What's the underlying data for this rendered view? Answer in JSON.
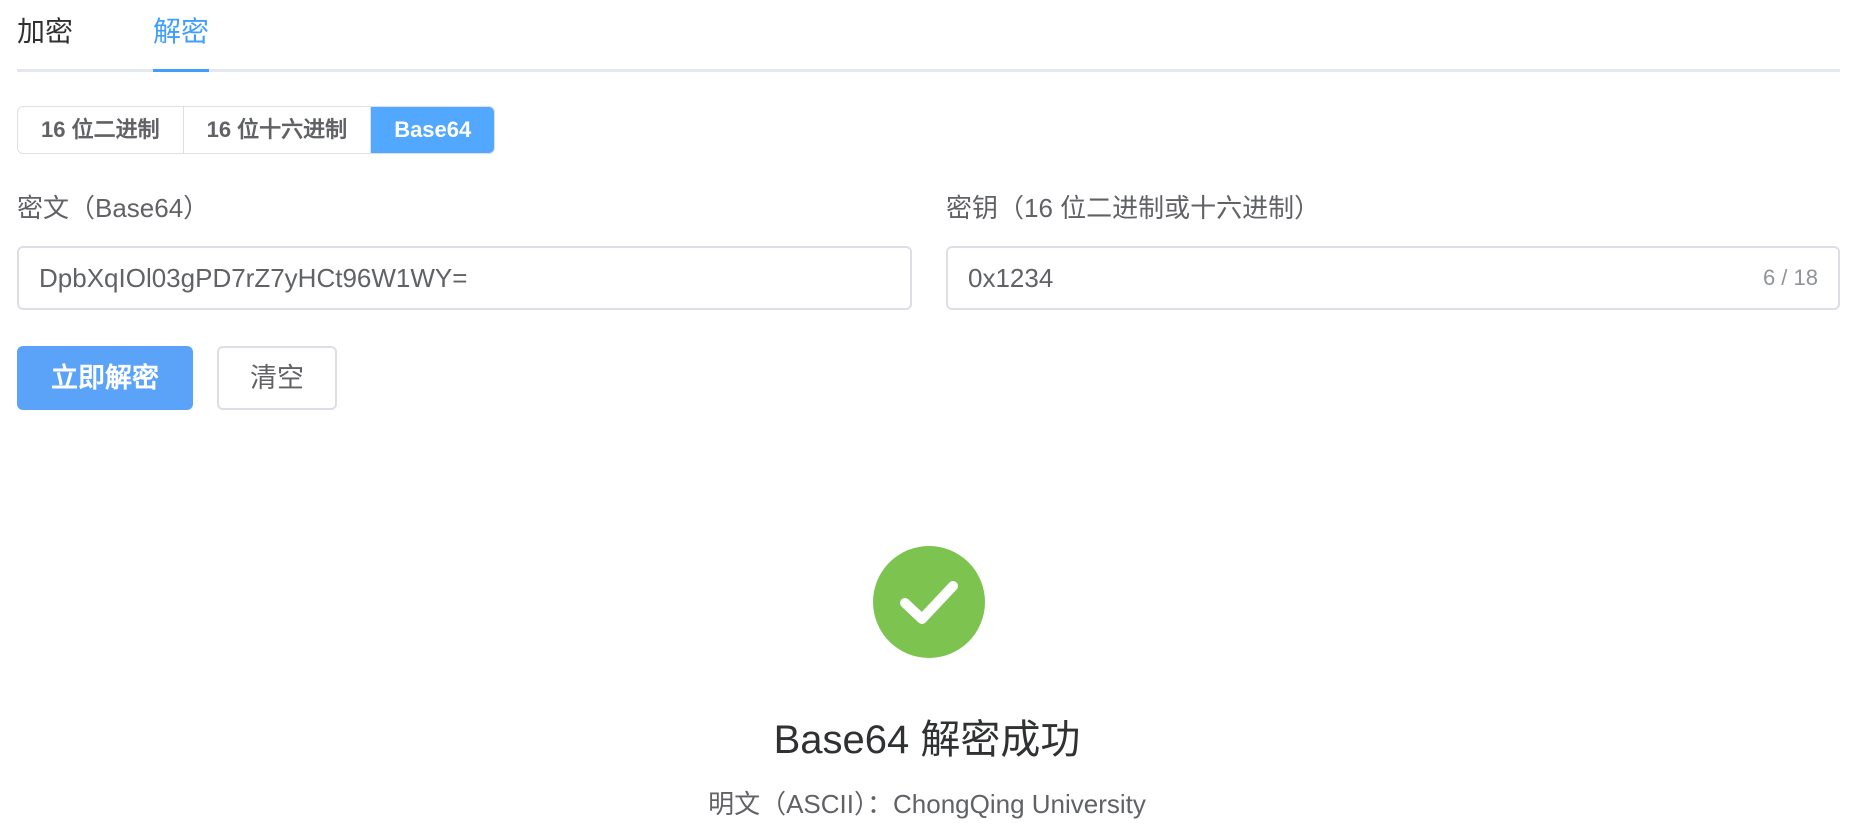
{
  "tabs": {
    "encrypt": "加密",
    "decrypt": "解密",
    "active": "解密"
  },
  "format_group": {
    "options": [
      "16 位二进制",
      "16 位十六进制",
      "Base64"
    ],
    "selected": "Base64"
  },
  "cipher_field": {
    "label": "密文（Base64）",
    "value": "DpbXqIOl03gPD7rZ7yHCt96W1WY="
  },
  "key_field": {
    "label": "密钥（16 位二进制或十六进制）",
    "value": "0x1234",
    "counter": "6 / 18"
  },
  "actions": {
    "decrypt_now": "立即解密",
    "clear": "清空"
  },
  "result": {
    "status": "success",
    "icon": "check-circle-icon",
    "title": "Base64 解密成功",
    "plaintext_label": "明文（ASCII）：",
    "plaintext_value": "ChongQing University"
  },
  "colors": {
    "accent": "#409eff",
    "success": "#7cc350"
  }
}
